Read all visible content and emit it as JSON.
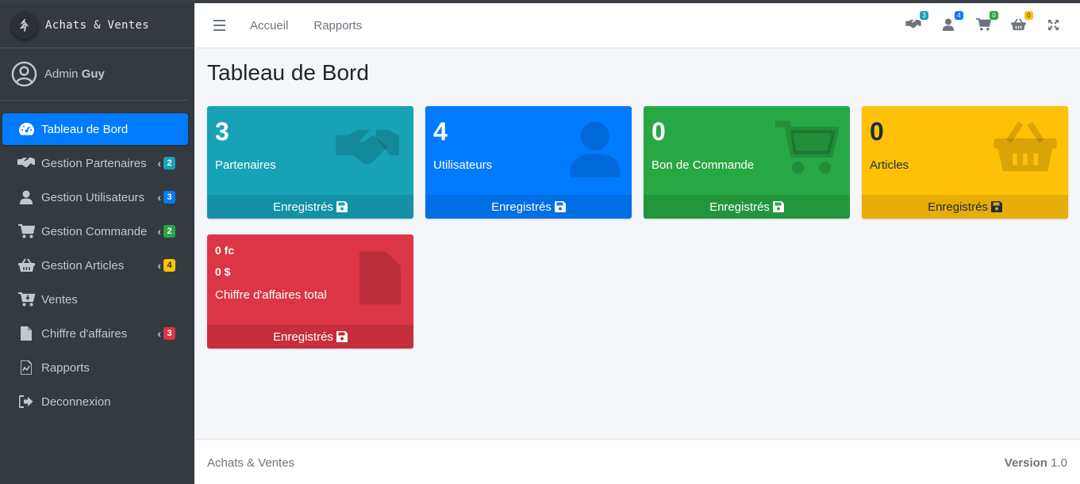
{
  "brand": {
    "title": "Achats & Ventes"
  },
  "user": {
    "prefix": "Admin",
    "name": "Guy"
  },
  "sidebar": {
    "items": [
      {
        "label": "Tableau de Bord",
        "icon": "dashboard-icon",
        "active": true
      },
      {
        "label": "Gestion Partenaires",
        "icon": "handshake-icon",
        "badge": "2",
        "badge_color": "#17a2b8"
      },
      {
        "label": "Gestion Utilisateurs",
        "icon": "user-icon",
        "badge": "3",
        "badge_color": "#007bff"
      },
      {
        "label": "Gestion Commande",
        "icon": "cart-icon",
        "badge": "2",
        "badge_color": "#28a745"
      },
      {
        "label": "Gestion Articles",
        "icon": "basket-icon",
        "badge": "4",
        "badge_color": "#ffc107"
      },
      {
        "label": "Ventes",
        "icon": "cart-arrow-icon"
      },
      {
        "label": "Chiffre d'affaires",
        "icon": "file-icon",
        "badge": "3",
        "badge_color": "#dc3545"
      },
      {
        "label": "Rapports",
        "icon": "file-chart-icon"
      },
      {
        "label": "Deconnexion",
        "icon": "logout-icon"
      }
    ]
  },
  "navbar": {
    "links": [
      "Accueil",
      "Rapports"
    ],
    "icons": [
      {
        "name": "handshake-icon",
        "badge": "3",
        "color": "#17a2b8"
      },
      {
        "name": "users-icon",
        "badge": "4",
        "color": "#007bff"
      },
      {
        "name": "cart-icon",
        "badge": "0",
        "color": "#28a745"
      },
      {
        "name": "basket-icon",
        "badge": "0",
        "color": "#ffc107"
      }
    ]
  },
  "page": {
    "title": "Tableau de Bord"
  },
  "boxes": [
    {
      "value": "3",
      "label": "Partenaires",
      "footer": "Enregistrés",
      "color": "#17a2b8"
    },
    {
      "value": "4",
      "label": "Utilisateurs",
      "footer": "Enregistrés",
      "color": "#007bff"
    },
    {
      "value": "0",
      "label": "Bon de Commande",
      "footer": "Enregistrés",
      "color": "#28a745"
    },
    {
      "value": "0",
      "label": "Articles",
      "footer": "Enregistrés",
      "color": "#ffc107"
    }
  ],
  "revenue_box": {
    "fc": "0 fc",
    "usd": "0 $",
    "label": "Chiffre d'affaires total",
    "footer": "Enregistrés",
    "color": "#dc3545"
  },
  "footer": {
    "left": "Achats & Ventes",
    "version_label": "Version",
    "version": "1.0"
  }
}
